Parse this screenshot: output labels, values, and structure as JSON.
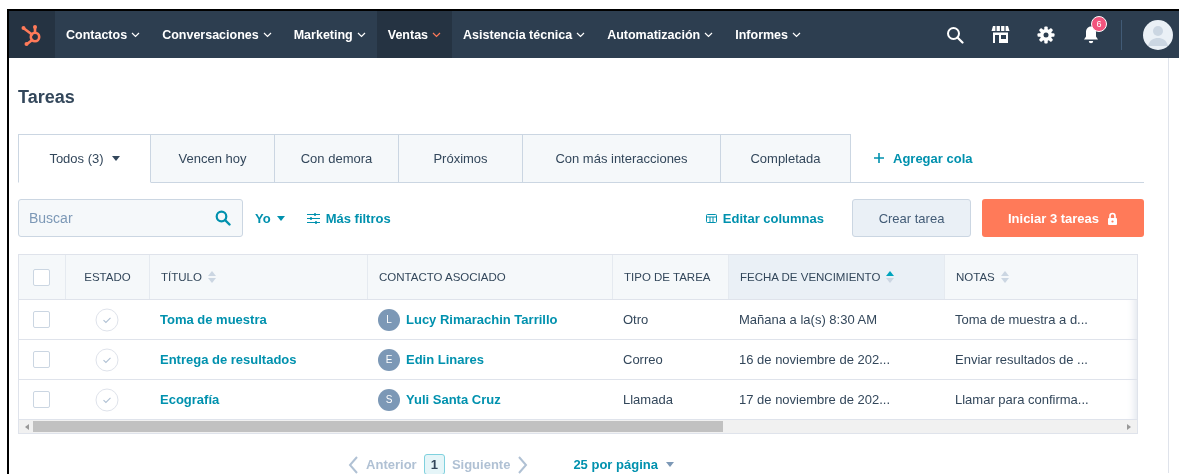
{
  "nav": {
    "items": [
      {
        "label": "Contactos",
        "selected": false
      },
      {
        "label": "Conversaciones",
        "selected": false
      },
      {
        "label": "Marketing",
        "selected": false
      },
      {
        "label": "Ventas",
        "selected": true
      },
      {
        "label": "Asistencia técnica",
        "selected": false
      },
      {
        "label": "Automatización",
        "selected": false
      },
      {
        "label": "Informes",
        "selected": false
      }
    ],
    "notification_count": "6"
  },
  "page_title": "Tareas",
  "tabs": [
    {
      "label": "Todos (3)",
      "selected": true,
      "dropdown": true
    },
    {
      "label": "Vencen hoy",
      "selected": false,
      "dropdown": false
    },
    {
      "label": "Con demora",
      "selected": false,
      "dropdown": false
    },
    {
      "label": "Próximos",
      "selected": false,
      "dropdown": false
    },
    {
      "label": "Con más interacciones",
      "selected": false,
      "dropdown": false
    },
    {
      "label": "Completada",
      "selected": false,
      "dropdown": false
    }
  ],
  "add_queue": "Agregar cola",
  "search": {
    "placeholder": "Buscar"
  },
  "owner_filter": "Yo",
  "more_filters": "Más filtros",
  "edit_columns": "Editar columnas",
  "create_task": "Crear tarea",
  "start_tasks": "Iniciar 3 tareas",
  "table": {
    "select_all_checked": false,
    "columns": [
      {
        "label": "ESTADO",
        "sortable": false
      },
      {
        "label": "TÍTULO",
        "sortable": true,
        "sorted": false
      },
      {
        "label": "CONTACTO ASOCIADO",
        "sortable": false
      },
      {
        "label": "TIPO DE TAREA",
        "sortable": false
      },
      {
        "label": "FECHA DE VENCIMIENTO",
        "sortable": true,
        "sorted": true
      },
      {
        "label": "NOTAS",
        "sortable": true,
        "sorted": false
      }
    ],
    "rows": [
      {
        "checked": false,
        "completed": false,
        "title": "Toma de muestra",
        "contact_initial": "L",
        "contact": "Lucy Rimarachin Tarrillo",
        "type": "Otro",
        "due": "Mañana a la(s) 8:30 AM",
        "notes": "Toma de muestra a d..."
      },
      {
        "checked": false,
        "completed": false,
        "title": "Entrega de resultados",
        "contact_initial": "E",
        "contact": "Edin Linares",
        "type": "Correo",
        "due": "16 de noviembre de 202...",
        "notes": "Enviar resultados de ..."
      },
      {
        "checked": false,
        "completed": false,
        "title": "Ecografía",
        "contact_initial": "S",
        "contact": "Yuli Santa Cruz",
        "type": "Llamada",
        "due": "17 de noviembre de 202...",
        "notes": "Llamar para confirma..."
      }
    ]
  },
  "pagination": {
    "previous": "Anterior",
    "page": "1",
    "next": "Siguiente",
    "per_page": "25 por página"
  }
}
